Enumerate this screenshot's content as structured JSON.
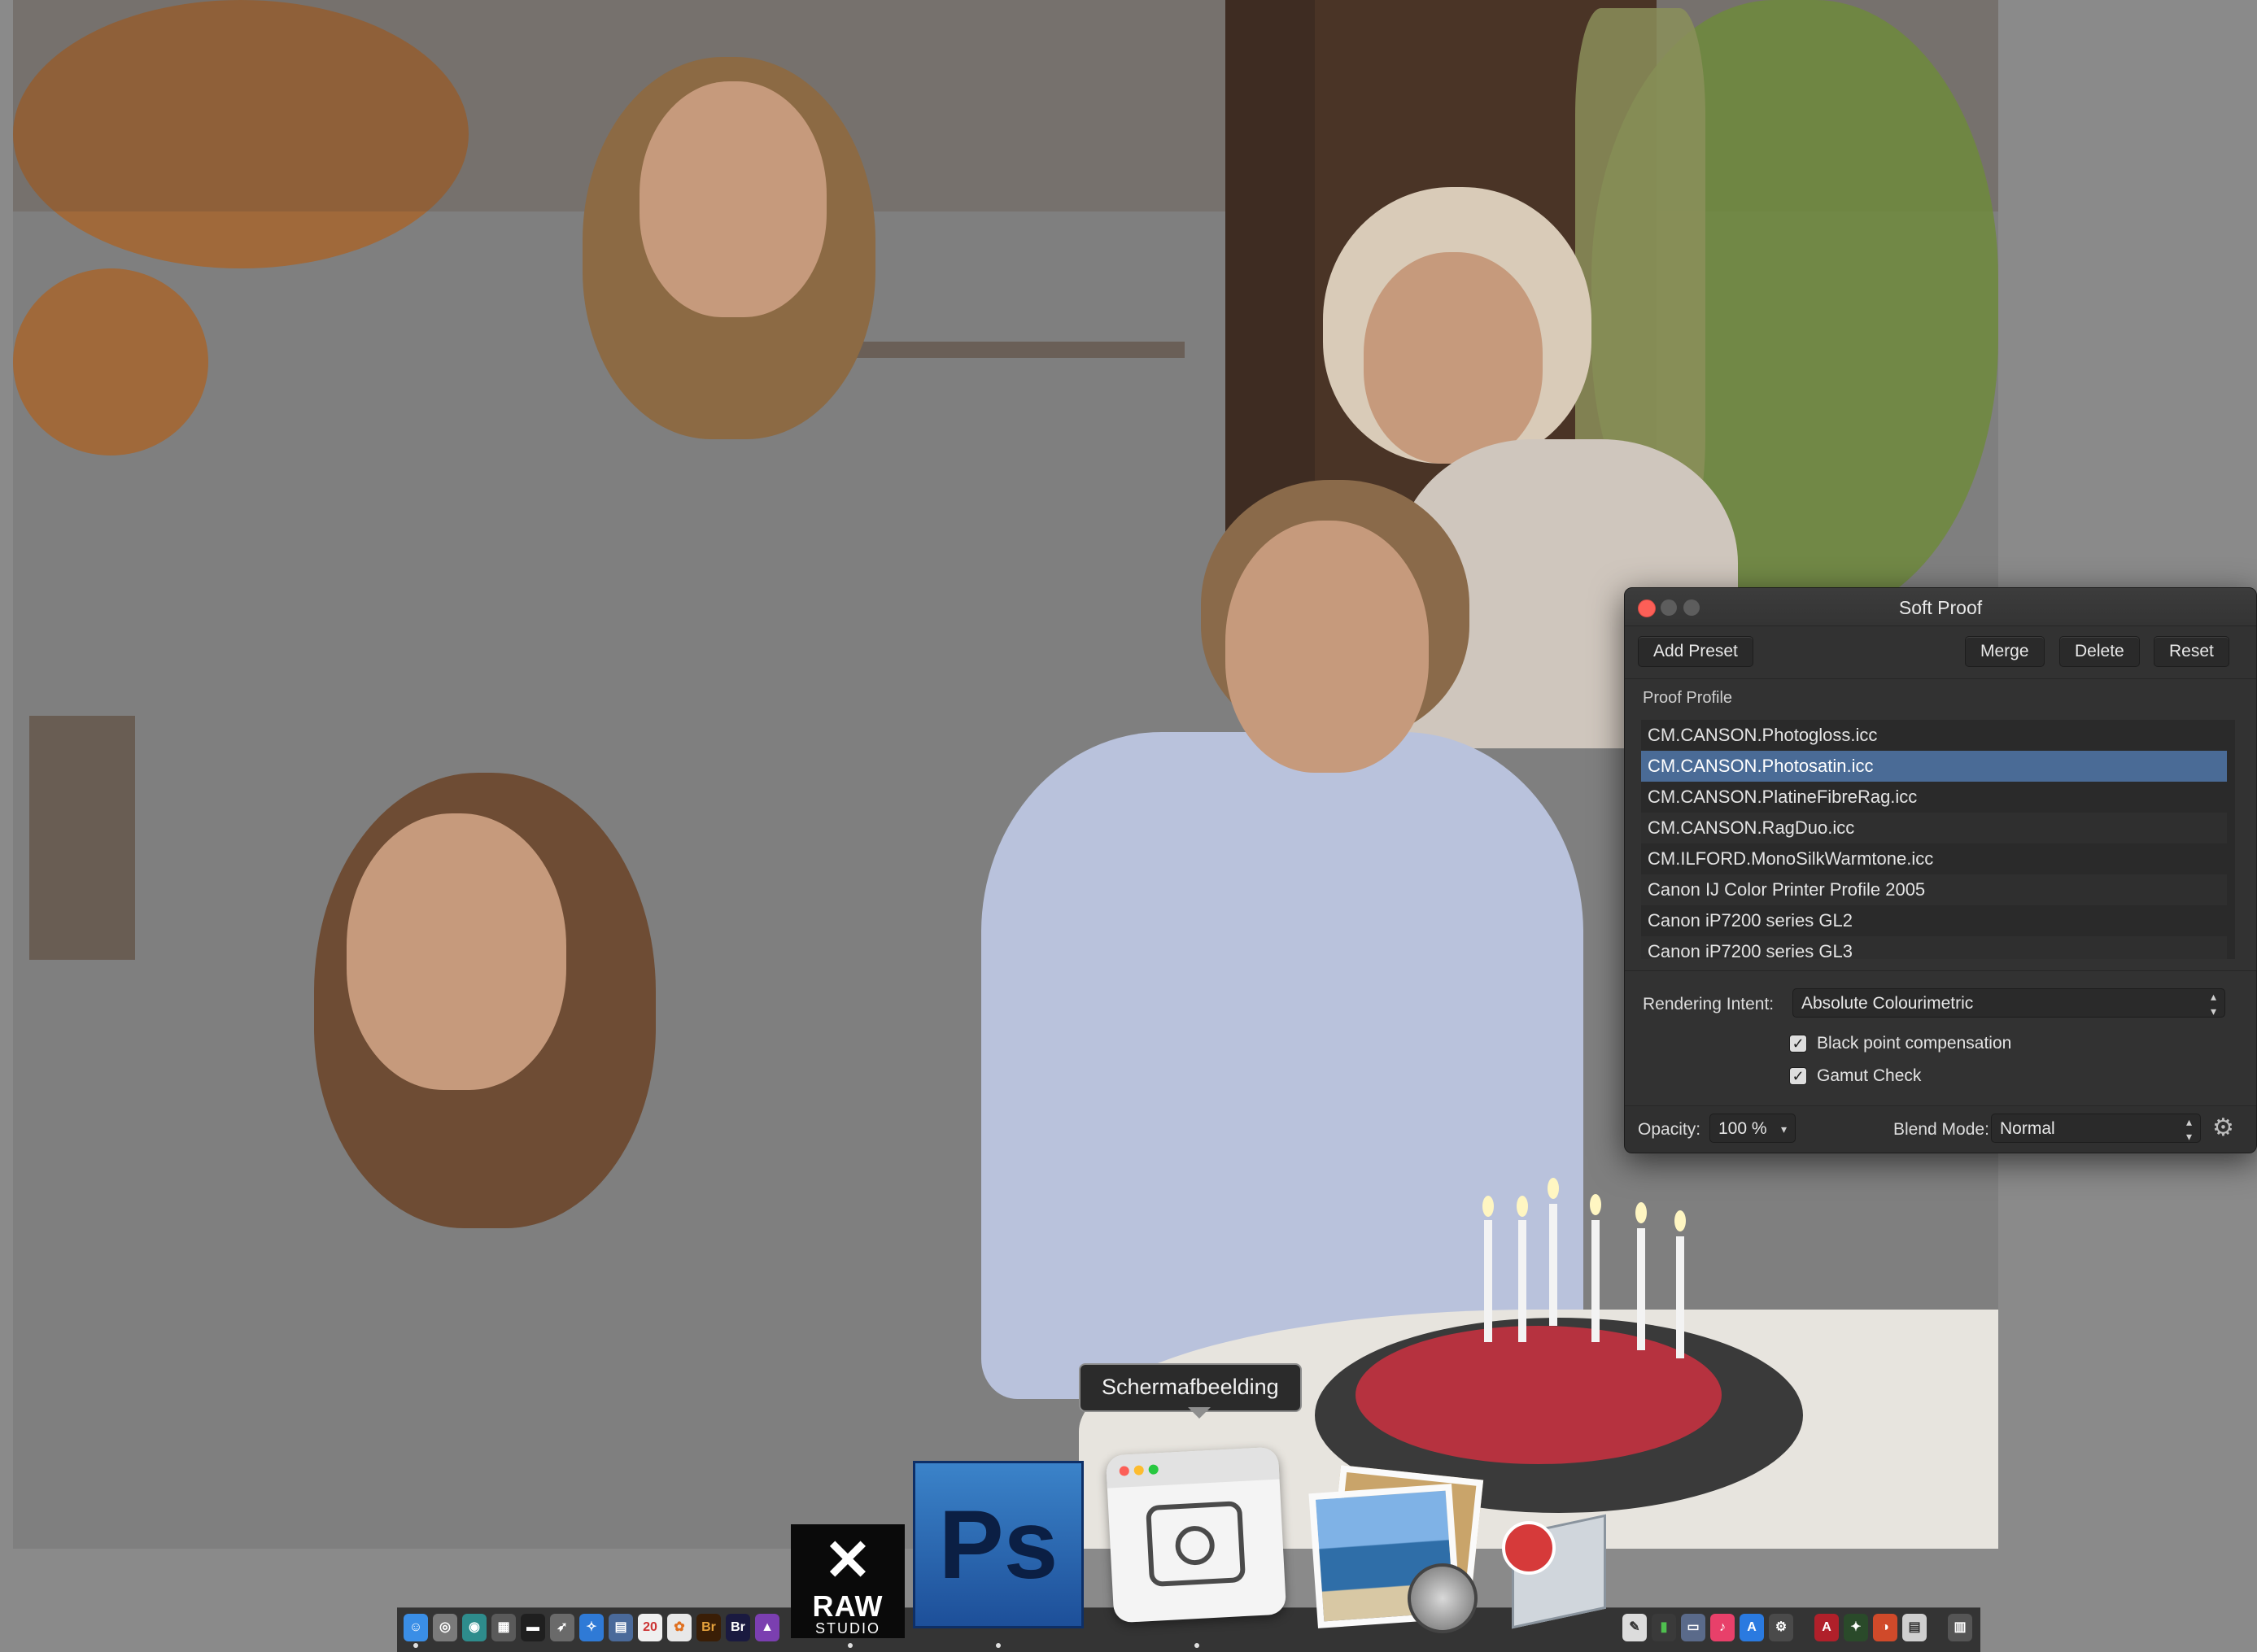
{
  "soft_proof": {
    "title": "Soft Proof",
    "buttons": {
      "add_preset": "Add Preset",
      "merge": "Merge",
      "delete": "Delete",
      "reset": "Reset"
    },
    "proof_profile_label": "Proof Profile",
    "profiles": [
      "CM.CANSON.Photogloss.icc",
      "CM.CANSON.Photosatin.icc",
      "CM.CANSON.PlatineFibreRag.icc",
      "CM.CANSON.RagDuo.icc",
      "CM.ILFORD.MonoSilkWarmtone.icc",
      "Canon IJ Color Printer Profile 2005",
      "Canon iP7200 series GL2",
      "Canon iP7200 series GL3"
    ],
    "selected_profile": "CM.CANSON.Photosatin.icc",
    "rendering_intent_label": "Rendering Intent:",
    "rendering_intent_value": "Absolute Colourimetric",
    "black_point_label": "Black point compensation",
    "black_point_checked": true,
    "gamut_check_label": "Gamut Check",
    "gamut_check_checked": true,
    "opacity_label": "Opacity:",
    "opacity_value": "100 %",
    "blend_mode_label": "Blend Mode:",
    "blend_mode_value": "Normal"
  },
  "tooltip": {
    "text": "Schermafbeelding"
  },
  "dock": {
    "apps": [
      {
        "name": "RAW FILE CONVERTER",
        "icon": "raw-studio-icon",
        "label_main": "RAW",
        "label_sub": "STUDIO"
      },
      {
        "name": "Photoshop",
        "icon": "photoshop-icon",
        "label": "Ps"
      },
      {
        "name": "Schermafbeelding",
        "icon": "screenshot-icon"
      },
      {
        "name": "Preview",
        "icon": "preview-icon"
      },
      {
        "name": "Image Capture",
        "icon": "image-capture-icon"
      }
    ],
    "mini_icons": [
      "finder-icon",
      "launchpad-icon",
      "safari-icon",
      "bridge-icon",
      "bridge-icon-2",
      "affinity-icon",
      "calendar-icon",
      "music-icon",
      "app-store-icon",
      "trash-icon"
    ],
    "mini_labels": {
      "bridge1": "Br",
      "bridge2": "Br",
      "calendar": "20"
    }
  },
  "colors": {
    "selection": "#4a6b96",
    "close_button": "#fc5f57",
    "panel_bg": "#323232"
  }
}
